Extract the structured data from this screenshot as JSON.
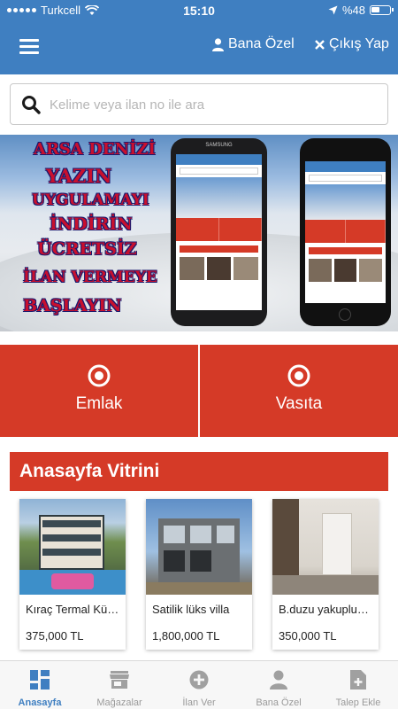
{
  "status": {
    "carrier": "Turkcell",
    "time": "15:10",
    "battery": "%48"
  },
  "header": {
    "profile_label": "Bana Özel",
    "logout_label": "Çıkış Yap"
  },
  "search": {
    "placeholder": "Kelime veya ilan no ile ara",
    "value": ""
  },
  "banner": {
    "lines": [
      "ARSA DENİZİ",
      "YAZIN",
      "UYGULAMAYI",
      "İNDİRİN",
      "ÜCRETSİZ",
      "İLAN VERMEYE",
      "BAŞLAYIN"
    ],
    "phone1_brand": "SAMSUNG"
  },
  "categories": [
    {
      "label": "Emlak",
      "icon": "target-icon"
    },
    {
      "label": "Vasıta",
      "icon": "target-icon"
    }
  ],
  "vitrin": {
    "title": "Anasayfa Vitrini",
    "items": [
      {
        "title": "Kıraç Termal Kür ...",
        "price": "375,000 TL"
      },
      {
        "title": "Satilik lüks villa",
        "price": "1,800,000 TL"
      },
      {
        "title": "B.duzu yakupludu...",
        "price": "350,000 TL"
      }
    ]
  },
  "tabs": [
    {
      "label": "Anasayfa",
      "icon": "dashboard-icon",
      "active": true
    },
    {
      "label": "Mağazalar",
      "icon": "store-icon",
      "active": false
    },
    {
      "label": "İlan Ver",
      "icon": "add-circle-icon",
      "active": false
    },
    {
      "label": "Bana Özel",
      "icon": "person-icon",
      "active": false
    },
    {
      "label": "Talep Ekle",
      "icon": "file-add-icon",
      "active": false
    }
  ],
  "colors": {
    "primary": "#3f7fc1",
    "accent": "#d53a27"
  }
}
